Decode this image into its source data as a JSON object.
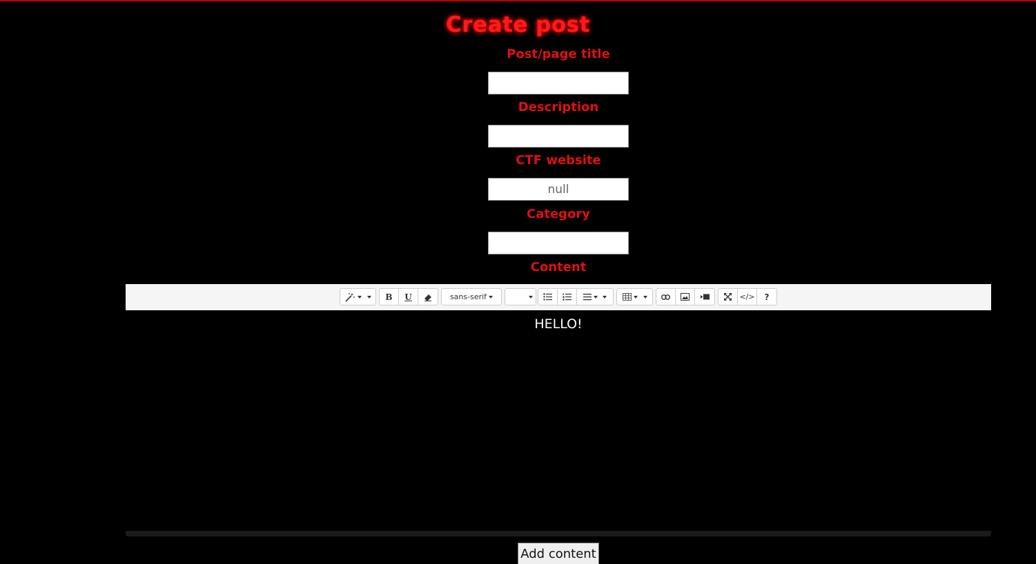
{
  "page": {
    "title": "Create post"
  },
  "form": {
    "title_label": "Post/page title",
    "title_value": "",
    "description_label": "Description",
    "description_value": "",
    "ctf_label": "CTF website",
    "ctf_placeholder": "null",
    "category_label": "Category",
    "category_value": "",
    "content_label": "Content"
  },
  "toolbar": {
    "font_family": "sans-serif",
    "font_size": "",
    "buttons": [
      "magic-wand",
      "bold",
      "underline",
      "eraser",
      "font-family",
      "font-size",
      "unordered-list",
      "ordered-list",
      "paragraph-align",
      "table",
      "link",
      "picture",
      "video",
      "fullscreen",
      "code-view",
      "help"
    ],
    "bold_glyph": "B",
    "underline_glyph": "U",
    "codeview_glyph": "</>",
    "help_glyph": "?"
  },
  "editor": {
    "content": "HELLO!"
  },
  "submit": {
    "label": "Add content"
  },
  "colors": {
    "background": "#000000",
    "accent": "#ff1a1a",
    "label": "#e01010"
  }
}
